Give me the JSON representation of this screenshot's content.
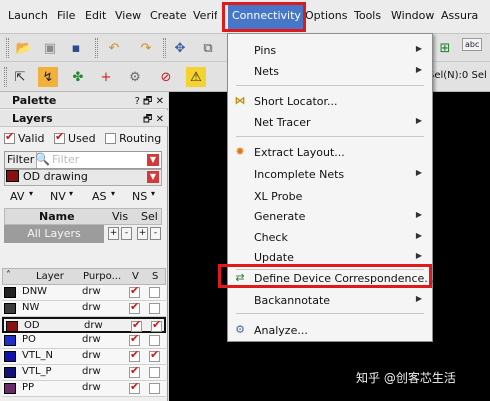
{
  "menubar": {
    "items": [
      "Launch",
      "File",
      "Edit",
      "View",
      "Create",
      "Verify",
      "Connectivity",
      "Options",
      "Tools",
      "Window",
      "Assura"
    ],
    "active": "Connectivity"
  },
  "toolbar": {
    "selection_text": "Sel(N):0  Sel",
    "abc_label": "abc"
  },
  "palette": {
    "title": "Palette",
    "title_buttons": "? 🗗 ✕",
    "layers_title": "Layers",
    "layers_buttons": "🗗 ✕",
    "checks": [
      {
        "label": "Valid",
        "checked": true
      },
      {
        "label": "Used",
        "checked": true
      },
      {
        "label": "Routing",
        "checked": false
      }
    ],
    "filter_label": "Filter",
    "filter_placeholder": "Filter",
    "current_layer": "OD drawing",
    "visibility": [
      "AV",
      "NV",
      "AS",
      "NS"
    ],
    "grid_headers": {
      "name": "Name",
      "vis": "Vis",
      "sel": "Sel"
    },
    "all_layers": "All Layers",
    "layer_headers": {
      "layer": "Layer",
      "purpose": "Purpo...",
      "v": "V",
      "s": "S"
    },
    "layers": [
      {
        "name": "DNW",
        "purpose": "drw",
        "v": true,
        "s": false,
        "color": "#222222"
      },
      {
        "name": "NW",
        "purpose": "drw",
        "v": true,
        "s": false,
        "color": "#3a3a3a"
      },
      {
        "name": "OD",
        "purpose": "drw",
        "v": true,
        "s": true,
        "color": "#8a1010",
        "selected": true
      },
      {
        "name": "PO",
        "purpose": "drw",
        "v": true,
        "s": false,
        "color": "#1c2fc7"
      },
      {
        "name": "VTL_N",
        "purpose": "drw",
        "v": true,
        "s": true,
        "color": "#1111aa"
      },
      {
        "name": "VTL_P",
        "purpose": "drw",
        "v": true,
        "s": false,
        "color": "#111177"
      },
      {
        "name": "PP",
        "purpose": "drw",
        "v": true,
        "s": false,
        "color": "#6a2a6a"
      }
    ]
  },
  "connectivity_menu": {
    "items": [
      {
        "label": "Pins",
        "submenu": true,
        "icon": "none"
      },
      {
        "label": "Nets",
        "submenu": true,
        "icon": "none"
      },
      {
        "label": "Short Locator...",
        "submenu": false,
        "icon": "short-locator-icon"
      },
      {
        "label": "Net Tracer",
        "submenu": true,
        "icon": "none"
      },
      {
        "label": "Extract Layout...",
        "submenu": false,
        "icon": "extract-icon"
      },
      {
        "label": "Incomplete Nets",
        "submenu": true,
        "icon": "none"
      },
      {
        "label": "XL Probe",
        "submenu": false,
        "icon": "none"
      },
      {
        "label": "Generate",
        "submenu": true,
        "icon": "none"
      },
      {
        "label": "Check",
        "submenu": true,
        "icon": "none"
      },
      {
        "label": "Update",
        "submenu": true,
        "icon": "none"
      },
      {
        "label": "Define Device Correspondence...",
        "submenu": false,
        "icon": "device-correspondence-icon",
        "highlighted": true
      },
      {
        "label": "Backannotate",
        "submenu": true,
        "icon": "none"
      },
      {
        "label": "Analyze...",
        "submenu": false,
        "icon": "analyze-icon"
      }
    ]
  },
  "watermark": "知乎 @创客芯生活",
  "colors": {
    "highlight_red": "#e01a1a",
    "menu_active_blue": "#4777c9",
    "canvas_bg": "#000000"
  }
}
